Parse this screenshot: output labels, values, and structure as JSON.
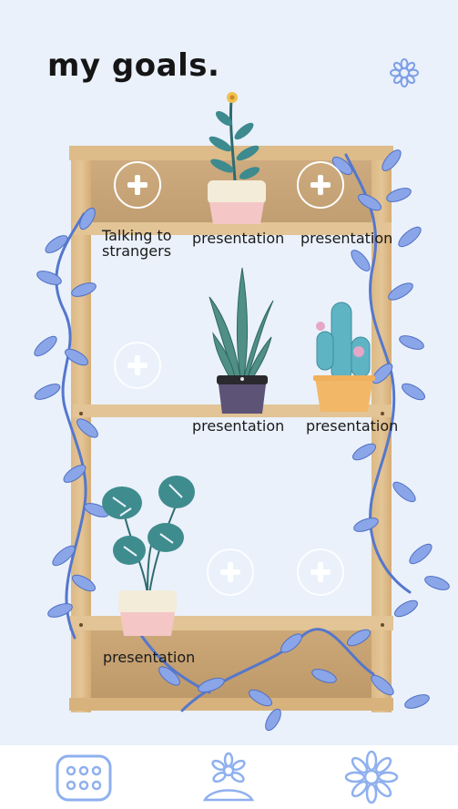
{
  "header": {
    "title": "my goals.",
    "settings_icon": "gear-flower-icon"
  },
  "colors": {
    "background": "#eaf1fb",
    "wood": "#d9b57f",
    "wood_dark": "#c49a5f",
    "vine": "#5b7fd1",
    "leaf": "#8aa6e8",
    "tab_icon": "#8fb0ef"
  },
  "shelves": {
    "top": {
      "slots": [
        {
          "label": "Talking to strangers",
          "label_line1": "Talking to",
          "label_line2": "strangers",
          "state": "add"
        },
        {
          "label": "presentation",
          "state": "plant",
          "plant": "flower-in-pot"
        },
        {
          "label": "presentation",
          "state": "add"
        }
      ]
    },
    "middle": {
      "slots": [
        {
          "label": "",
          "state": "empty"
        },
        {
          "label": "presentation",
          "state": "plant",
          "plant": "snake-plant"
        },
        {
          "label": "presentation",
          "state": "plant",
          "plant": "cactus"
        }
      ]
    },
    "bottom": {
      "slots": [
        {
          "label": "presentation",
          "state": "plant",
          "plant": "monstera"
        },
        {
          "label": "",
          "state": "empty"
        },
        {
          "label": "",
          "state": "empty"
        }
      ]
    }
  },
  "tabbar": {
    "items": [
      {
        "name": "calendar-grid-icon"
      },
      {
        "name": "growing-flower-icon"
      },
      {
        "name": "flower-icon"
      }
    ]
  }
}
